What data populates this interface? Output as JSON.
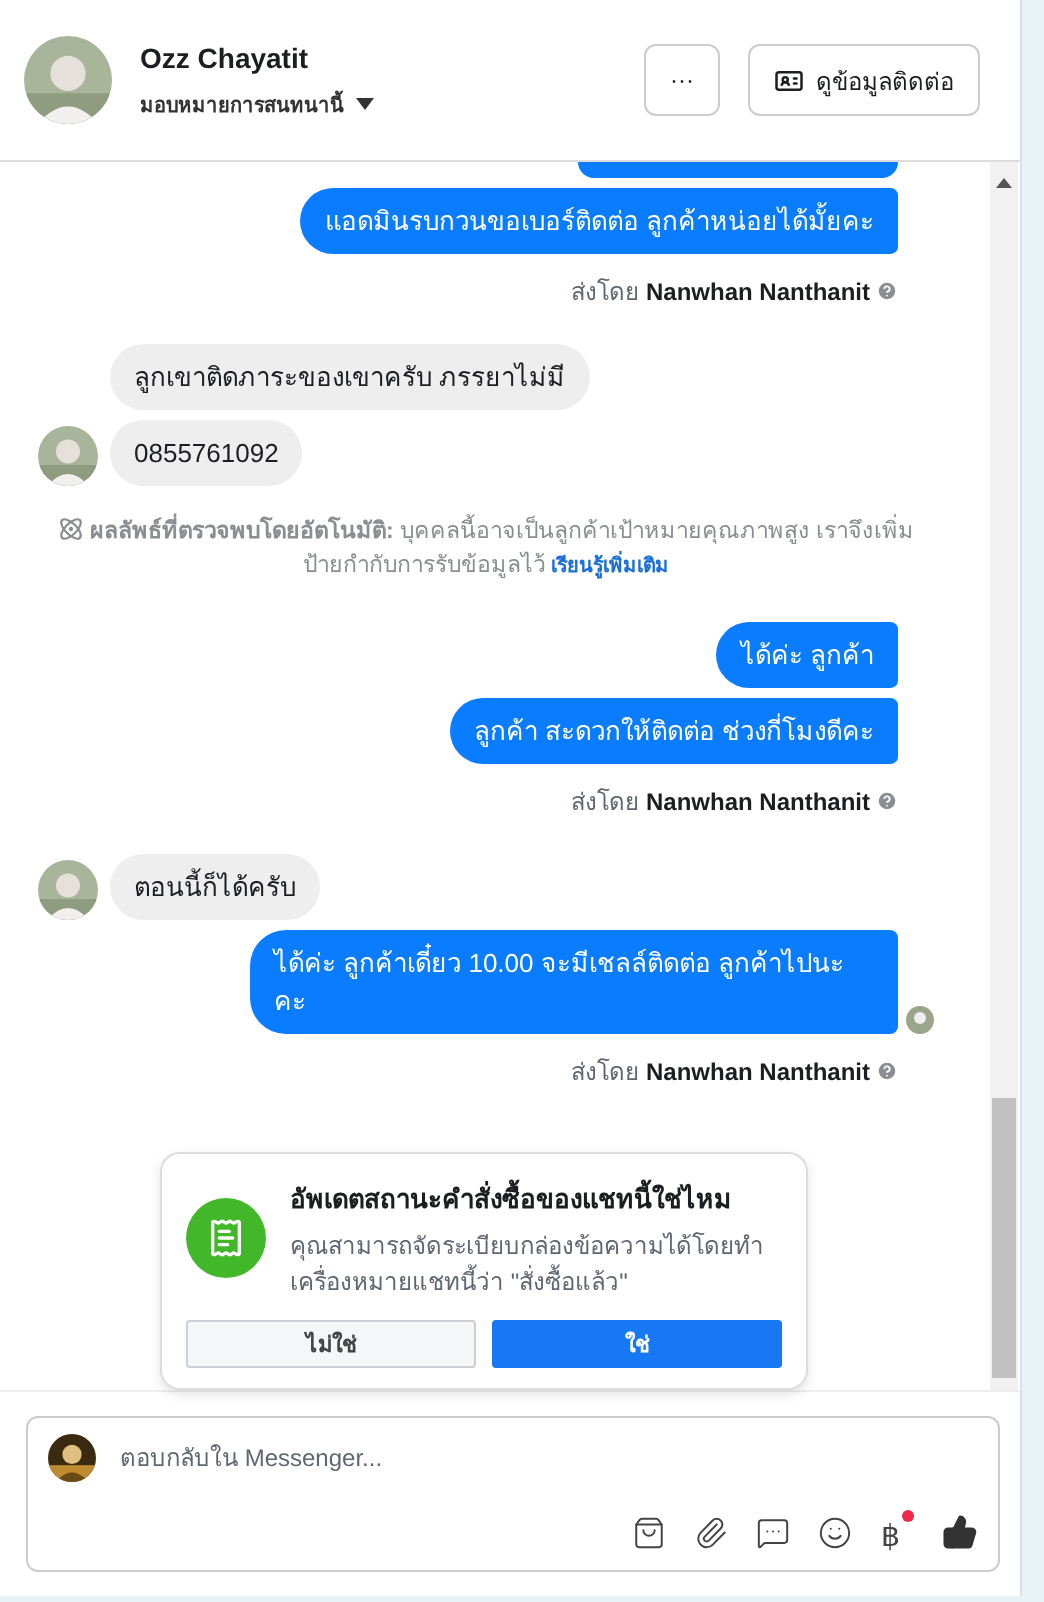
{
  "header": {
    "name": "Ozz Chayatit",
    "assign": "มอบหมายการสนทนานี้",
    "more_button": "···",
    "contact_button": "ดูข้อมูลติดต่อ"
  },
  "messages": [
    {
      "kind": "out",
      "text": "แอดมินรบกวนขอเบอร์ติดต่อ ลูกค้าหน่อยได้มั้ยคะ",
      "seen": false
    },
    {
      "kind": "sent_by",
      "prefix": "ส่งโดย",
      "name": "Nanwhan Nanthanit"
    },
    {
      "kind": "in",
      "text": "ลูกเขาติดภาระของเขาครับ ภรรยาไม่มี",
      "avatar": false
    },
    {
      "kind": "in",
      "text": "0855761092",
      "avatar": true
    },
    {
      "kind": "notice",
      "label": "ผลลัพธ์ที่ตรวจพบโดยอัตโนมัติ:",
      "text": "บุคคลนี้อาจเป็นลูกค้าเป้าหมายคุณภาพสูง เราจึงเพิ่มป้ายกำกับการรับข้อมูลไว้",
      "link": "เรียนรู้เพิ่มเติม"
    },
    {
      "kind": "out",
      "text": "ได้ค่ะ ลูกค้า",
      "seen": false
    },
    {
      "kind": "out",
      "text": "ลูกค้า สะดวกให้ติดต่อ ช่วงกี่โมงดีคะ",
      "seen": false
    },
    {
      "kind": "sent_by",
      "prefix": "ส่งโดย",
      "name": "Nanwhan Nanthanit"
    },
    {
      "kind": "in",
      "text": "ตอนนี้ก็ได้ครับ",
      "avatar": true
    },
    {
      "kind": "out",
      "text": "ได้ค่ะ ลูกค้าเดี๋ยว 10.00 จะมีเชลล์ติดต่อ ลูกค้าไปนะคะ",
      "seen": true
    },
    {
      "kind": "sent_by",
      "prefix": "ส่งโดย",
      "name": "Nanwhan Nanthanit"
    }
  ],
  "card": {
    "title": "อัพเดตสถานะคำสั่งซื้อของแชทนี้ใช่ไหม",
    "body": "คุณสามารถจัดระเบียบกล่องข้อความได้โดยทำเครื่องหมายแชทนี้ว่า \"สั่งซื้อแล้ว\"",
    "no_button": "ไม่ใช่",
    "yes_button": "ใช่"
  },
  "composer": {
    "placeholder": "ตอบกลับใน Messenger...",
    "currency_symbol": "฿"
  }
}
